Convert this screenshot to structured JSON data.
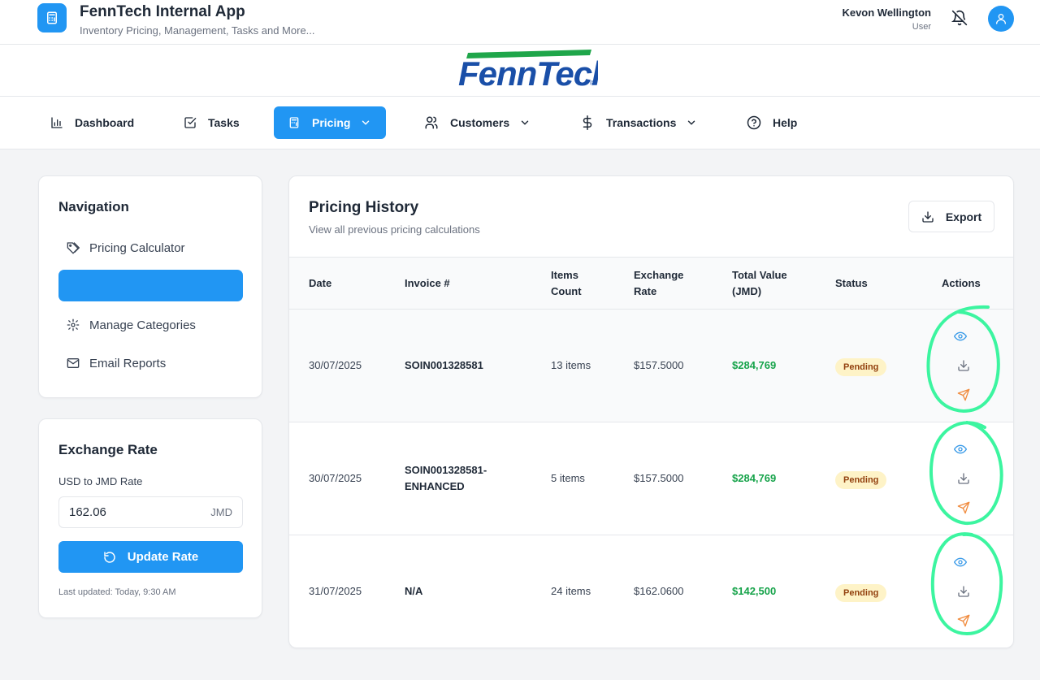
{
  "header": {
    "app_title": "FennTech Internal App",
    "app_subtitle": "Inventory Pricing, Management, Tasks and More...",
    "user_name": "Kevon Wellington",
    "user_role": "User"
  },
  "logo": {
    "text": "FennTech",
    "mark": "®"
  },
  "nav": {
    "items": [
      {
        "label": "Dashboard",
        "icon": "bar-chart-icon"
      },
      {
        "label": "Tasks",
        "icon": "checkbox-icon"
      },
      {
        "label": "Pricing",
        "icon": "calculator-icon",
        "active": true
      },
      {
        "label": "Customers",
        "icon": "users-icon"
      },
      {
        "label": "Transactions",
        "icon": "dollar-icon"
      },
      {
        "label": "Help",
        "icon": "help-circle-icon"
      }
    ]
  },
  "sidebar": {
    "title": "Navigation",
    "items": [
      {
        "label": "Pricing Calculator",
        "icon": "tag-icon"
      },
      {
        "label": "",
        "active": true
      },
      {
        "label": "Manage Categories",
        "icon": "gear-icon"
      },
      {
        "label": "Email Reports",
        "icon": "mail-icon"
      }
    ]
  },
  "exchange": {
    "title": "Exchange Rate",
    "label": "USD to JMD Rate",
    "value": "162.06",
    "unit": "JMD",
    "button": "Update Rate",
    "last_updated": "Last updated: Today, 9:30 AM"
  },
  "history": {
    "title": "Pricing History",
    "subtitle": "View all previous pricing calculations",
    "export_label": "Export",
    "columns": {
      "date": "Date",
      "invoice": "Invoice #",
      "items_1": "Items",
      "items_2": "Count",
      "rate_1": "Exchange",
      "rate_2": "Rate",
      "total_1": "Total Value",
      "total_2": "(JMD)",
      "status": "Status",
      "actions": "Actions"
    },
    "rows": [
      {
        "date": "30/07/2025",
        "invoice_1": "SOIN001328581",
        "invoice_2": "",
        "items": "13 items",
        "rate": "$157.5000",
        "total": "$284,769",
        "status": "Pending"
      },
      {
        "date": "30/07/2025",
        "invoice_1": "SOIN001328581-",
        "invoice_2": "ENHANCED",
        "items": "5 items",
        "rate": "$157.5000",
        "total": "$284,769",
        "status": "Pending"
      },
      {
        "date": "31/07/2025",
        "invoice_1": "N/A",
        "invoice_2": "",
        "items": "24 items",
        "rate": "$162.0600",
        "total": "$142,500",
        "status": "Pending"
      }
    ]
  },
  "colors": {
    "accent": "#2196f3",
    "money": "#16a34a",
    "pending_bg": "#fef3c7",
    "annotation": "#3cf5a0",
    "view_icon": "#3b9be8",
    "send_icon": "#f08a3c"
  }
}
